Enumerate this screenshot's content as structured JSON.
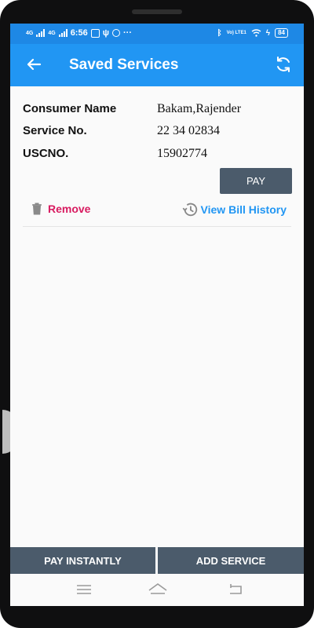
{
  "status_bar": {
    "network_1": "4G",
    "network_2": "4G",
    "time": "6:56",
    "extra": "···",
    "volte": "Vo) LTE1",
    "battery": "84"
  },
  "app_bar": {
    "title": "Saved Services",
    "back_icon": "arrow-left-icon",
    "refresh_icon": "refresh-icon"
  },
  "service": {
    "consumer_name_label": "Consumer Name",
    "consumer_name": "Bakam,Rajender",
    "service_no_label": "Service No.",
    "service_no": "22 34 02834",
    "uscno_label": "USCNO.",
    "uscno": "15902774",
    "pay_label": "PAY",
    "remove_label": "Remove",
    "history_label": "View Bill History"
  },
  "footer": {
    "pay_instantly_label": "PAY INSTANTLY",
    "add_service_label": "ADD SERVICE"
  },
  "colors": {
    "primary": "#2196f3",
    "status_bar": "#1e88e5",
    "button": "#4b5b6b",
    "remove": "#d81b60"
  }
}
